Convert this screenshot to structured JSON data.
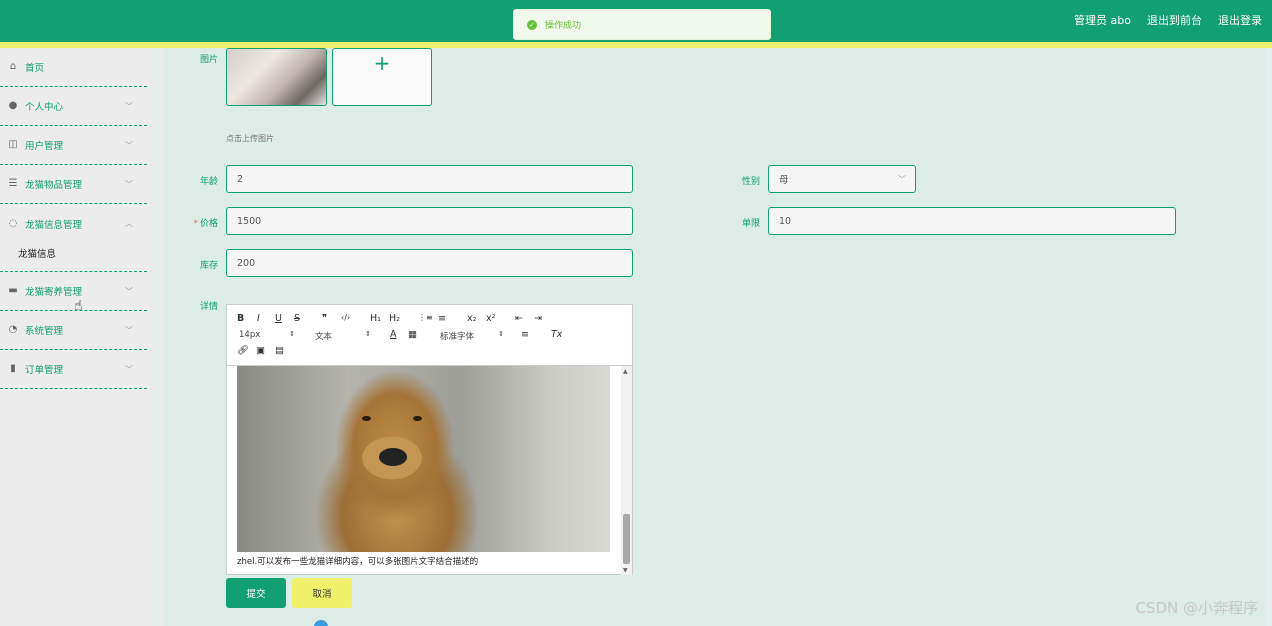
{
  "header": {
    "admin_label": "管理员 abo",
    "back_to_front": "退出到前台",
    "logout": "退出登录"
  },
  "toast": {
    "message": "操作成功"
  },
  "sidebar": {
    "items": [
      {
        "label": "首页",
        "icon": "home-icon"
      },
      {
        "label": "个人中心",
        "icon": "user-icon"
      },
      {
        "label": "用户管理",
        "icon": "users-icon"
      },
      {
        "label": "龙猫物品管理",
        "icon": "sliders-icon"
      },
      {
        "label": "龙猫信息管理",
        "icon": "compass-icon"
      },
      {
        "label": "龙猫寄养管理",
        "icon": "briefcase-icon"
      },
      {
        "label": "系统管理",
        "icon": "gauge-icon"
      },
      {
        "label": "订单管理",
        "icon": "chart-icon"
      }
    ],
    "submenu": {
      "label": "龙猫信息"
    }
  },
  "form": {
    "image_label": "图片",
    "upload_hint": "点击上传图片",
    "upload_plus": "+",
    "age_label": "年龄",
    "age_value": "2",
    "gender_label": "性别",
    "gender_value": "母",
    "price_label": "价格",
    "price_required": "*",
    "price_value": "1500",
    "limit_label": "单限",
    "limit_value": "10",
    "stock_label": "库存",
    "stock_value": "200",
    "detail_label": "详情",
    "submit_label": "提交",
    "cancel_label": "取消"
  },
  "editor": {
    "toolbar_row1": [
      "B",
      "I",
      "U",
      "S",
      "❞",
      "‹/›",
      "H₁",
      "H₂",
      "⋮≡",
      "≡",
      "x₂",
      "x²",
      "⇤",
      "⇥"
    ],
    "font_size": "14px",
    "paragraph": "文本",
    "font_family": "标准字体",
    "content_text": "zhel.可以发布一些龙猫详细内容，可以多张图片文字结合描述的"
  },
  "watermark": "CSDN @小奔程序"
}
